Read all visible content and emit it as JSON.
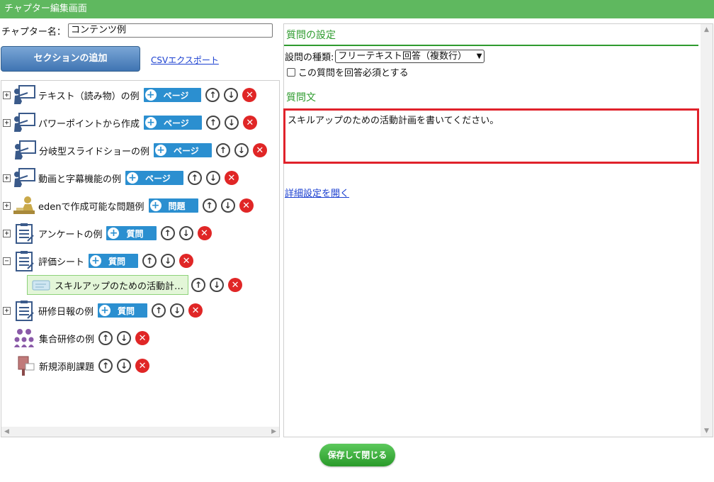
{
  "window": {
    "title": "チャプター編集画面"
  },
  "chapter": {
    "name_label": "チャプター名：",
    "name_value": "コンテンツ例"
  },
  "toolbar": {
    "add_section_label": "セクションの追加",
    "csv_export_label": "CSVエクスポート"
  },
  "tree": {
    "nodes": [
      {
        "label": "テキスト（読み物）の例",
        "expander": "+",
        "icon": "presentation-icon",
        "add_label": "ページ"
      },
      {
        "label": "パワーポイントから作成",
        "expander": "+",
        "icon": "presentation-icon",
        "add_label": "ページ"
      },
      {
        "label": "分岐型スライドショーの例",
        "expander": "",
        "icon": "presentation-icon",
        "add_label": "ページ"
      },
      {
        "label": "動画と字幕機能の例",
        "expander": "+",
        "icon": "presentation-icon",
        "add_label": "ページ"
      },
      {
        "label": "edenで作成可能な問題例",
        "expander": "+",
        "icon": "exam-icon",
        "add_label": "問題"
      },
      {
        "label": "アンケートの例",
        "expander": "+",
        "icon": "clipboard-icon",
        "add_label": "質問"
      },
      {
        "label": "評価シート",
        "expander": "−",
        "icon": "clipboard-icon",
        "add_label": "質問"
      },
      {
        "label": "研修日報の例",
        "expander": "+",
        "icon": "clipboard-icon",
        "add_label": "質問"
      },
      {
        "label": "集合研修の例",
        "expander": "",
        "icon": "group-icon",
        "add_label": ""
      },
      {
        "label": "新規添削課題",
        "expander": "",
        "icon": "post-icon",
        "add_label": ""
      }
    ],
    "child_node": {
      "label": "スキルアップのための活動計…",
      "icon": "ticket-icon"
    }
  },
  "question": {
    "section_title": "質問の設定",
    "type_label": "設問の種類:",
    "type_value": "フリーテキスト回答（複数行）",
    "required_label": "この質問を回答必須とする",
    "text_label": "質問文",
    "text_value": "スキルアップのための活動計画を書いてください。",
    "detail_link": "詳細設定を開く"
  },
  "footer": {
    "save_close_label": "保存して閉じる"
  },
  "colors": {
    "green": "#2e9b2e",
    "blue": "#2b8fd0",
    "red": "#e02626",
    "highlight": "#e0222b"
  }
}
